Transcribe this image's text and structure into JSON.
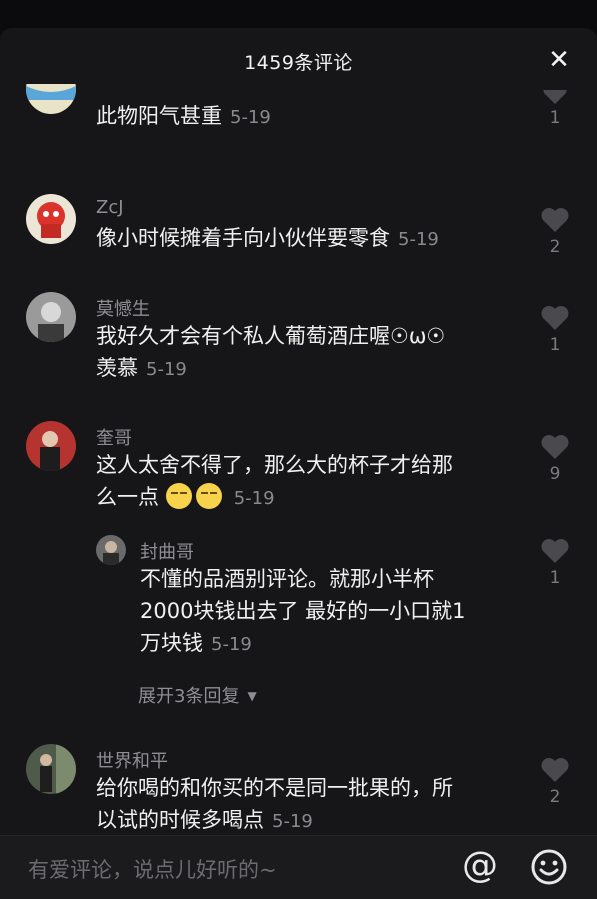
{
  "header": {
    "title": "1459条评论",
    "close": "✕"
  },
  "comments": [
    {
      "user": "",
      "text": "此物阳气甚重",
      "date": "5-19",
      "likes": "1"
    },
    {
      "user": "ZcJ",
      "text": "像小时候摊着手向小伙伴要零食",
      "date": "5-19",
      "likes": "2"
    },
    {
      "user": "莫憾生",
      "text_line1": "我好久才会有个私人葡萄酒庄喔☉ω☉",
      "text_line2": "羡慕",
      "date": "5-19",
      "likes": "1"
    },
    {
      "user": "奎哥",
      "text_line1": "这人太舍不得了，那么大的杯子才给那",
      "text_line2": "么一点",
      "date": "5-19",
      "likes": "9"
    },
    {
      "user": "封曲哥",
      "text_line1": "不懂的品酒别评论。就那小半杯",
      "text_line2": "2000块钱出去了 最好的一小口就1",
      "text_line3": "万块钱",
      "date": "5-19",
      "likes": "1"
    },
    {
      "user": "世界和平",
      "text_line1": "给你喝的和你买的不是同一批果的，所",
      "text_line2": "以试的时候多喝点",
      "date": "5-19",
      "likes": "2"
    }
  ],
  "expand_replies": "展开3条回复",
  "footer": {
    "placeholder": "有爱评论，说点儿好听的~",
    "at": "@"
  },
  "colors": {
    "background": "#161618",
    "text": "#f0f0f0",
    "muted": "#8e8e93"
  }
}
